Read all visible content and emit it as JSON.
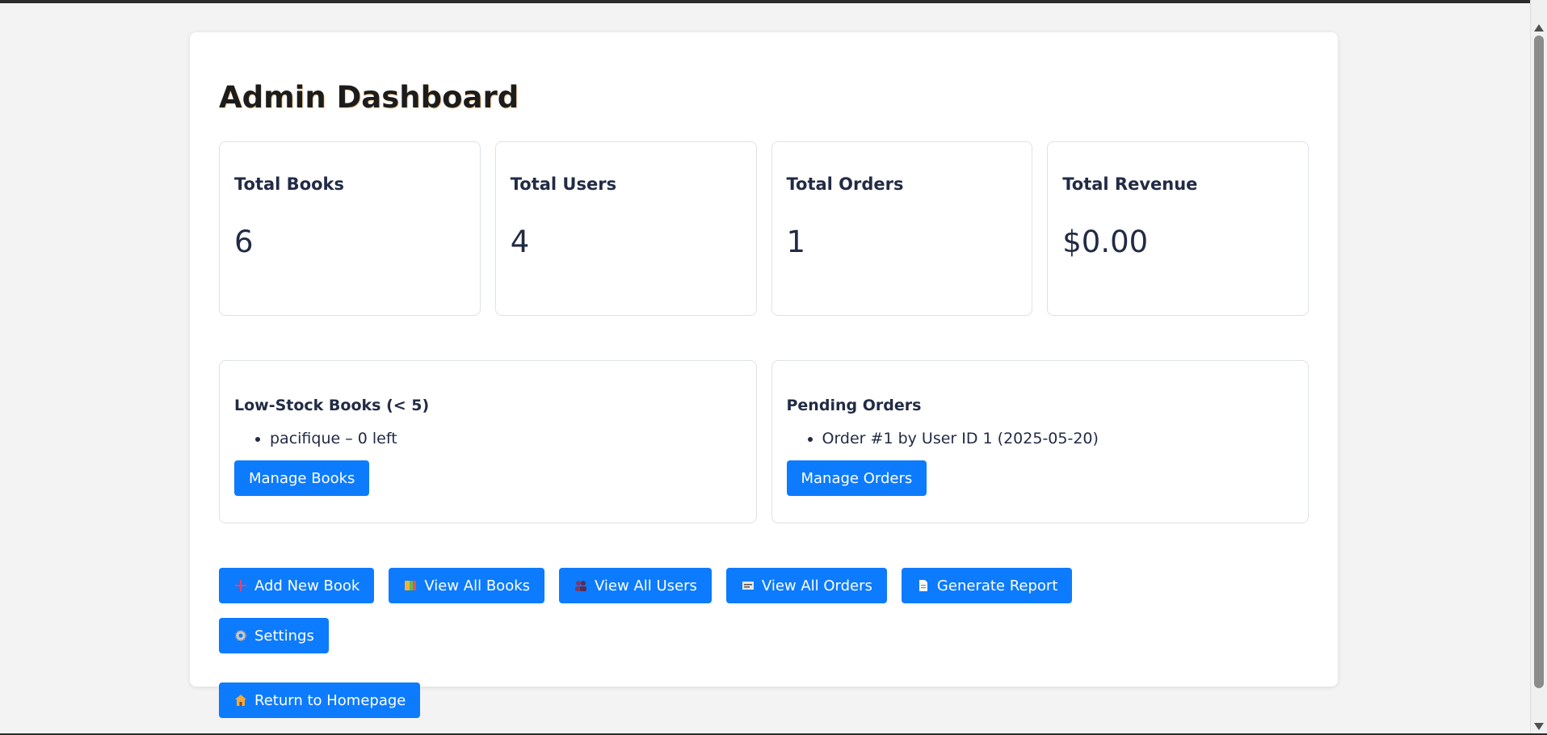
{
  "page": {
    "title": "Admin Dashboard"
  },
  "stats": [
    {
      "label": "Total Books",
      "value": "6"
    },
    {
      "label": "Total Users",
      "value": "4"
    },
    {
      "label": "Total Orders",
      "value": "1"
    },
    {
      "label": "Total Revenue",
      "value": "$0.00"
    }
  ],
  "low_stock": {
    "title": "Low-Stock Books (< 5)",
    "items": [
      "pacifique – 0 left"
    ],
    "button_label": "Manage Books"
  },
  "pending_orders": {
    "title": "Pending Orders",
    "items": [
      "Order #1 by User ID 1 (2025-05-20)"
    ],
    "button_label": "Manage Orders"
  },
  "actions": [
    {
      "label": "Add New Book",
      "icon": "plus-icon"
    },
    {
      "label": "View All Books",
      "icon": "books-icon"
    },
    {
      "label": "View All Users",
      "icon": "users-icon"
    },
    {
      "label": "View All Orders",
      "icon": "receipt-icon"
    },
    {
      "label": "Generate Report",
      "icon": "document-icon"
    },
    {
      "label": "Settings",
      "icon": "gear-icon"
    },
    {
      "label": "Return to Homepage",
      "icon": "house-icon"
    }
  ],
  "colors": {
    "primary": "#0d7bfd",
    "text": "#222b45",
    "background": "#f3f3f3"
  }
}
